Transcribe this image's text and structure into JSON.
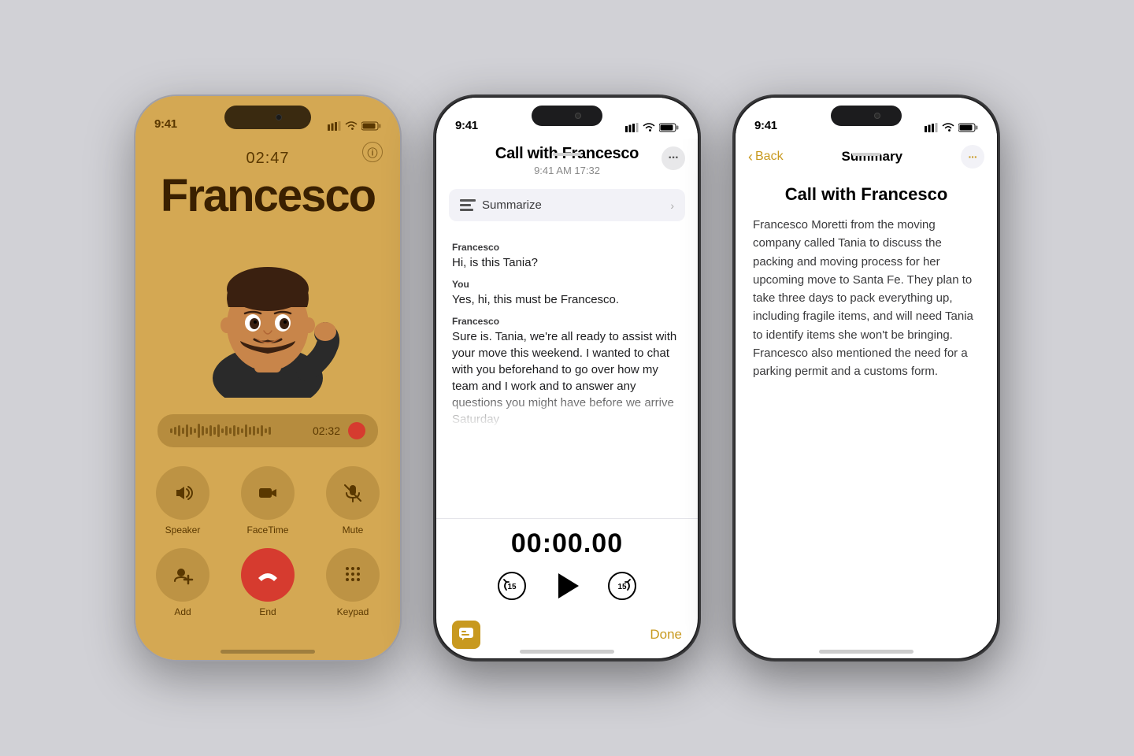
{
  "bg_color": "#d1d1d6",
  "phone1": {
    "status_time": "9:41",
    "call_timer": "02:47",
    "caller_name": "Francesco",
    "recording_time": "02:32",
    "buttons": [
      {
        "label": "Speaker",
        "icon": "🔊"
      },
      {
        "label": "FaceTime",
        "icon": "📹"
      },
      {
        "label": "Mute",
        "icon": "🎤"
      },
      {
        "label": "Add",
        "icon": "👤"
      },
      {
        "label": "End",
        "icon": "📞",
        "red": true
      },
      {
        "label": "Keypad",
        "icon": "⌨️"
      }
    ]
  },
  "phone2": {
    "status_time": "9:41",
    "title": "Call with Francesco",
    "subtitle": "9:41 AM  17:32",
    "summarize_label": "Summarize",
    "messages": [
      {
        "speaker": "Francesco",
        "text": "Hi, is this Tania?"
      },
      {
        "speaker": "You",
        "text": "Yes, hi, this must be Francesco."
      },
      {
        "speaker": "Francesco",
        "text": "Sure is. Tania, we're all ready to assist with your move this weekend. I wanted to chat with you beforehand to go over how my team and I work and to answer any questions you might have before we arrive Saturday"
      }
    ],
    "playback_timer": "00:00.00",
    "done_label": "Done",
    "bubble_icon": "💬"
  },
  "phone3": {
    "status_time": "9:41",
    "back_label": "Back",
    "nav_title": "Summary",
    "title": "Call with Francesco",
    "body": "Francesco Moretti from the moving company called Tania to discuss the packing and moving process for her upcoming move to Santa Fe. They plan to take three days to pack everything up, including fragile items, and will need Tania to identify items she won't be bringing. Francesco also mentioned the need for a parking permit and a customs form."
  }
}
